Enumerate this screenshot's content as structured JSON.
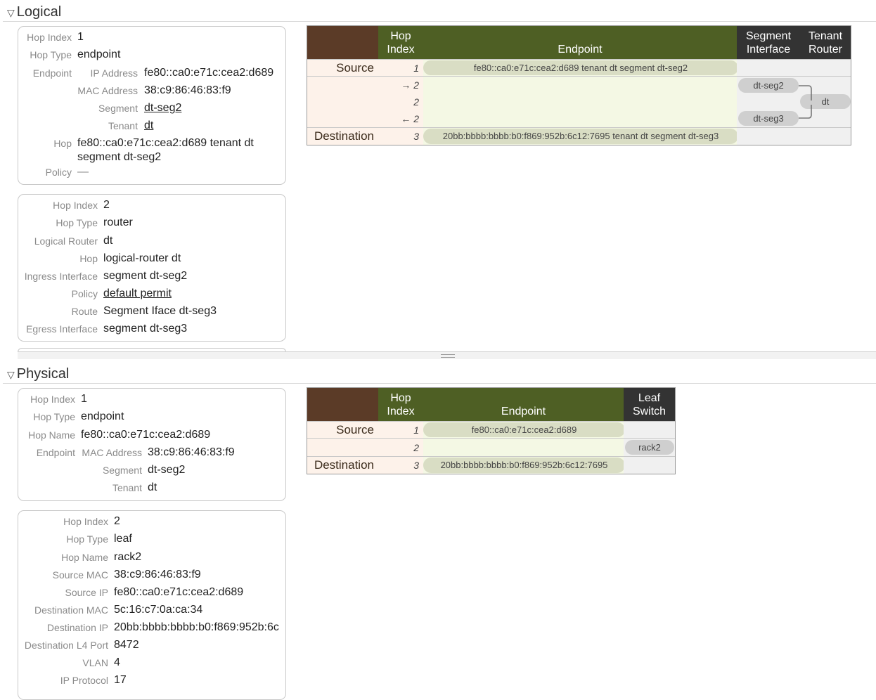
{
  "logical": {
    "title": "Logical",
    "card1": [
      {
        "key": "Hop Index",
        "value": "1"
      },
      {
        "key": "Hop Type",
        "value": "endpoint"
      },
      {
        "key": "Endpoint",
        "value": ""
      },
      {
        "key": "IP Address",
        "value": "fe80::ca0:e71c:cea2:d689"
      },
      {
        "key": "MAC Address",
        "value": "38:c9:86:46:83:f9"
      },
      {
        "key": "Segment",
        "value": "dt-seg2"
      },
      {
        "key": "Tenant",
        "value": "dt"
      },
      {
        "key": "Hop",
        "value": "fe80::ca0:e71c:cea2:d689 tenant dt"
      },
      {
        "key": "",
        "value": "segment dt-seg2"
      },
      {
        "key": "Policy",
        "value": "—"
      }
    ],
    "card2": [
      {
        "key": "Hop Index",
        "value": "2"
      },
      {
        "key": "Hop Type",
        "value": "router"
      },
      {
        "key": "Logical Router",
        "value": "dt"
      },
      {
        "key": "Hop",
        "value": "logical-router dt"
      },
      {
        "key": "Ingress Interface",
        "value": "segment dt-seg2"
      },
      {
        "key": "Policy",
        "value": "default permit"
      },
      {
        "key": "Route",
        "value": "Segment Iface dt-seg3"
      },
      {
        "key": "Egress Interface",
        "value": "segment dt-seg3"
      }
    ],
    "table": {
      "headers": {
        "hop_index": "Hop\nIndex",
        "endpoint": "Endpoint",
        "segment_interface": "Segment\nInterface",
        "tenant_router": "Tenant\nRouter"
      },
      "source_label": "Source",
      "destination_label": "Destination",
      "hops": [
        "1",
        "→ 2",
        "2",
        "← 2",
        "3"
      ],
      "source_endpoint": "fe80::ca0:e71c:cea2:d689 tenant dt segment dt-seg2",
      "destination_endpoint": "20bb:bbbb:bbbb:b0:f869:952b:6c12:7695 tenant dt segment dt-seg3",
      "seg_in": "dt-seg2",
      "seg_out": "dt-seg3",
      "router": "dt"
    }
  },
  "physical": {
    "title": "Physical",
    "card1": [
      {
        "key": "Hop Index",
        "value": "1"
      },
      {
        "key": "Hop Type",
        "value": "endpoint"
      },
      {
        "key": "Hop Name",
        "value": "fe80::ca0:e71c:cea2:d689"
      },
      {
        "key": "Endpoint",
        "value": ""
      },
      {
        "key": "MAC Address",
        "value": "38:c9:86:46:83:f9"
      },
      {
        "key": "Segment",
        "value": "dt-seg2"
      },
      {
        "key": "Tenant",
        "value": "dt"
      }
    ],
    "card2": [
      {
        "key": "Hop Index",
        "value": "2"
      },
      {
        "key": "Hop Type",
        "value": "leaf"
      },
      {
        "key": "Hop Name",
        "value": "rack2"
      },
      {
        "key": "Source MAC",
        "value": "38:c9:86:46:83:f9"
      },
      {
        "key": "Source IP",
        "value": "fe80::ca0:e71c:cea2:d689"
      },
      {
        "key": "Destination MAC",
        "value": "5c:16:c7:0a:ca:34"
      },
      {
        "key": "Destination IP",
        "value": "20bb:bbbb:bbbb:b0:f869:952b:6c"
      },
      {
        "key": "Destination L4 Port",
        "value": "8472"
      },
      {
        "key": "VLAN",
        "value": "4"
      },
      {
        "key": "IP Protocol",
        "value": "17"
      }
    ],
    "table": {
      "headers": {
        "hop_index": "Hop\nIndex",
        "endpoint": "Endpoint",
        "leaf_switch": "Leaf\nSwitch"
      },
      "source_label": "Source",
      "destination_label": "Destination",
      "hops": [
        "1",
        "2",
        "3"
      ],
      "source_endpoint": "fe80::ca0:e71c:cea2:d689",
      "destination_endpoint": "20bb:bbbb:bbbb:b0:f869:952b:6c12:7695",
      "leaf": "rack2"
    }
  },
  "colors": {
    "brown": "#5b3b27",
    "green": "#4e5f24",
    "dark": "#333333",
    "link": "#1a5ccf"
  },
  "icons": {
    "collapse": "triangle-down-icon"
  }
}
